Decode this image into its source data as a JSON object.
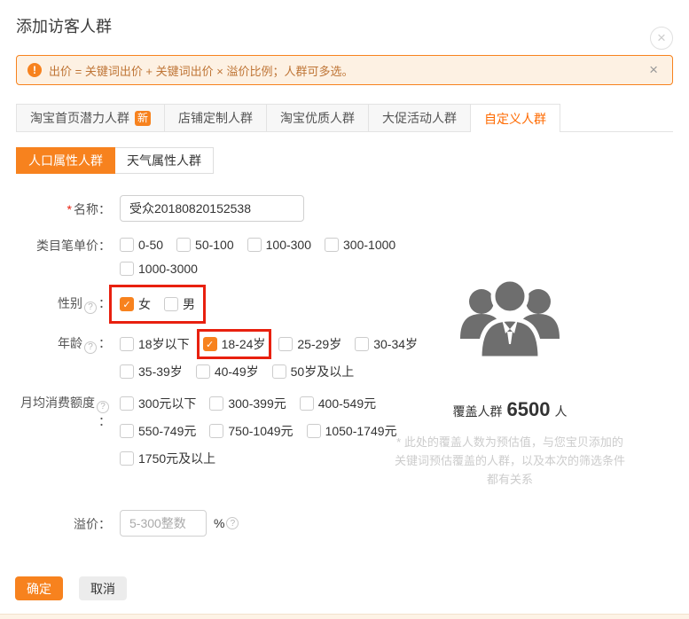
{
  "colors": {
    "accent_orange": "#f7821e",
    "tab_active_text": "#ff6a00",
    "highlight_red": "#e8200f",
    "notice_bg": "#fdf1e3",
    "notice_border": "#f7821e",
    "notice_text": "#bf7536",
    "people_icon_gray": "#6e6e6e"
  },
  "dialog": {
    "title": "添加访客人群",
    "close_icon": "×"
  },
  "notice": {
    "icon": "!",
    "text": "出价 = 关键词出价 + 关键词出价 × 溢价比例；人群可多选。",
    "close": "×"
  },
  "tabs": [
    {
      "label": "淘宝首页潜力人群",
      "badge": "新",
      "active": false
    },
    {
      "label": "店铺定制人群",
      "active": false
    },
    {
      "label": "淘宝优质人群",
      "active": false
    },
    {
      "label": "大促活动人群",
      "active": false
    },
    {
      "label": "自定义人群",
      "active": true
    }
  ],
  "subtabs": [
    {
      "label": "人口属性人群",
      "active": true
    },
    {
      "label": "天气属性人群",
      "active": false
    }
  ],
  "help_icon": "?",
  "form": {
    "name": {
      "required": "*",
      "label": "名称",
      "colon": "：",
      "value": "受众20180820152538"
    },
    "category_price": {
      "label": "类目笔单价",
      "colon": "：",
      "rows": [
        [
          {
            "label": "0-50"
          },
          {
            "label": "50-100"
          },
          {
            "label": "100-300"
          },
          {
            "label": "300-1000"
          }
        ],
        [
          {
            "label": "1000-3000"
          }
        ]
      ]
    },
    "gender": {
      "label": "性别",
      "colon": "：",
      "group_highlighted": true,
      "rows": [
        [
          {
            "label": "女",
            "checked": true
          },
          {
            "label": "男"
          }
        ]
      ]
    },
    "age": {
      "label": "年龄",
      "colon": "：",
      "rows": [
        [
          {
            "label": "18岁以下"
          },
          {
            "label": "18-24岁",
            "checked": true,
            "highlighted": true
          },
          {
            "label": "25-29岁"
          },
          {
            "label": "30-34岁"
          }
        ],
        [
          {
            "label": "35-39岁"
          },
          {
            "label": "40-49岁"
          },
          {
            "label": "50岁及以上"
          }
        ]
      ]
    },
    "monthly_spend": {
      "label": "月均消费额度",
      "colon": "：",
      "rows": [
        [
          {
            "label": "300元以下"
          },
          {
            "label": "300-399元"
          },
          {
            "label": "400-549元"
          }
        ],
        [
          {
            "label": "550-749元"
          },
          {
            "label": "750-1049元"
          },
          {
            "label": "1050-1749元"
          }
        ],
        [
          {
            "label": "1750元及以上"
          }
        ]
      ]
    },
    "premium": {
      "label": "溢价",
      "colon": "：",
      "placeholder": "5-300整数",
      "unit": "%"
    }
  },
  "coverage": {
    "label": "覆盖人群",
    "count": "6500",
    "unit": "人",
    "note_line1": "* 此处的覆盖人数为预估值，与您宝贝添加的",
    "note_line2": "关键词预估覆盖的人群，以及本次的筛选条件",
    "note_line3": "都有关系"
  },
  "footer": {
    "confirm": "确定",
    "cancel": "取消"
  }
}
